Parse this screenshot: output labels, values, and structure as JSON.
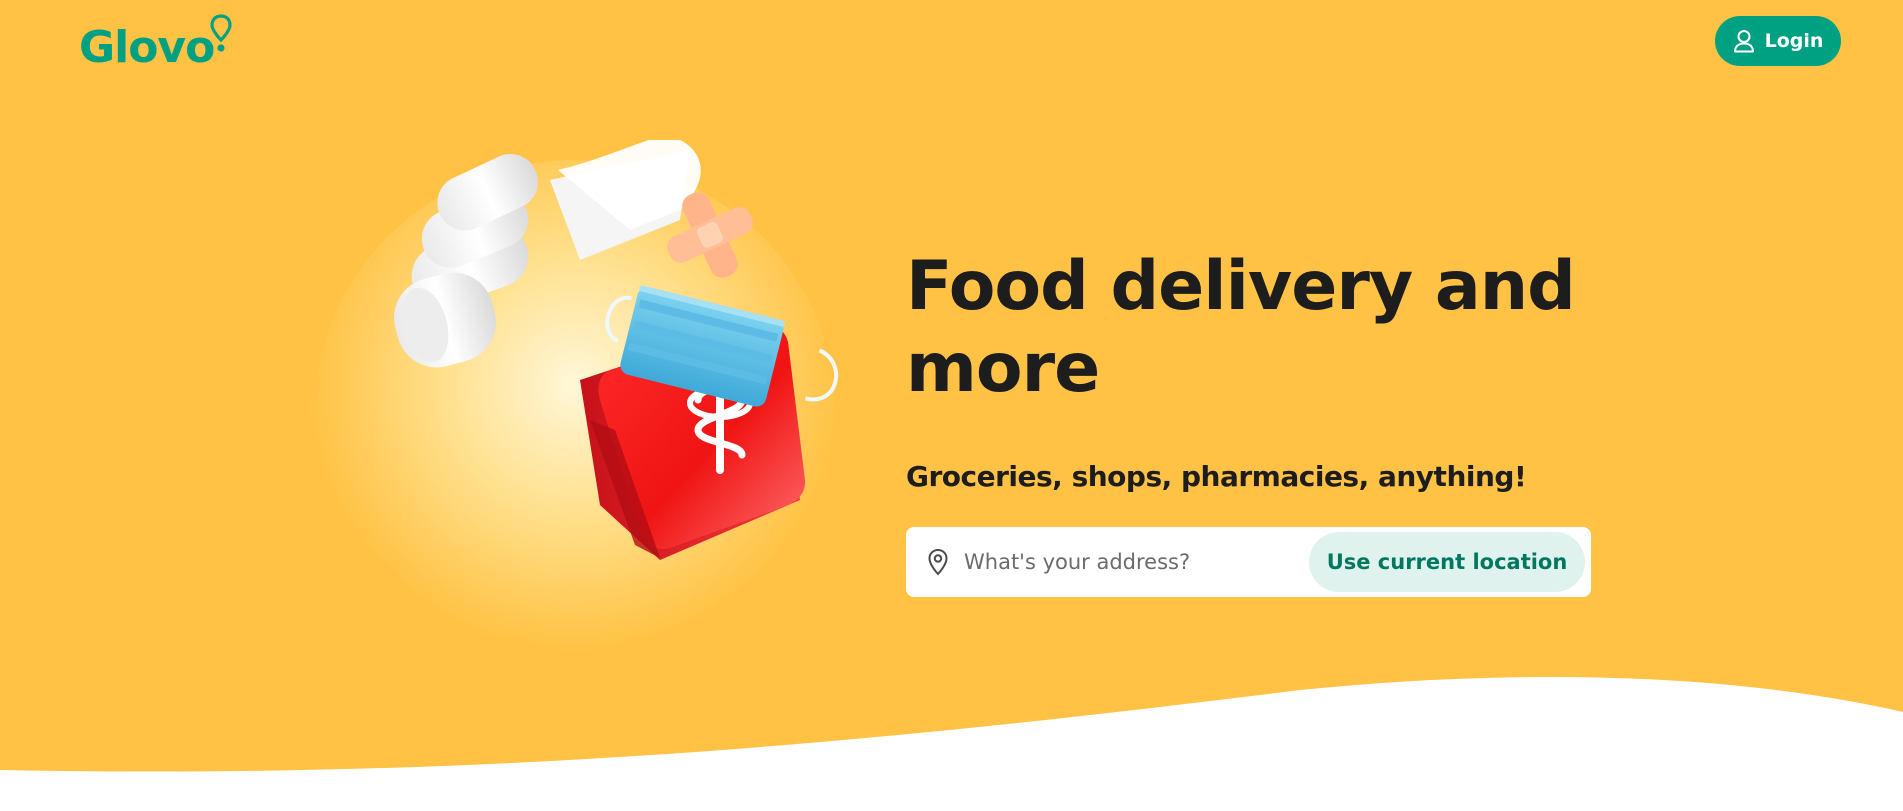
{
  "colors": {
    "background": "#FFC244",
    "brand_green": "#00A082",
    "text_dark": "#1D1D1D",
    "location_button_bg": "#E0F2EE",
    "location_button_text": "#00775F"
  },
  "header": {
    "logo_text": "Glovo",
    "logo_icon": "location-pin-icon",
    "login_label": "Login",
    "login_icon": "user-icon"
  },
  "hero": {
    "title": "Food delivery and more",
    "subtitle": "Groceries, shops, pharmacies, anything!",
    "illustration": "first-aid-kit-illustration",
    "address_placeholder": "What's your address?",
    "address_value": "",
    "address_icon": "map-pin-icon",
    "location_button_label": "Use current location"
  }
}
